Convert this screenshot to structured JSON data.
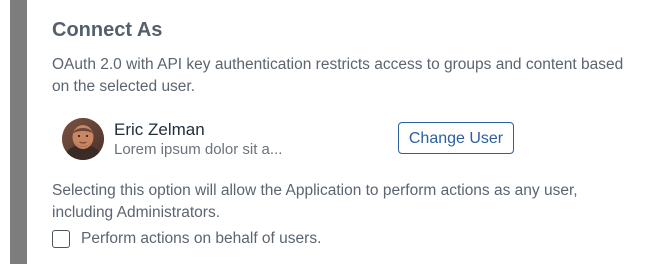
{
  "section": {
    "title": "Connect As",
    "description": "OAuth 2.0 with API key authentication restricts access to groups and content based on the selected user."
  },
  "user": {
    "name": "Eric Zelman",
    "subtext": "Lorem ipsum dolor sit a..."
  },
  "actions": {
    "change_user_label": "Change User"
  },
  "note": {
    "text": "Selecting this option will allow the Application to perform actions as any user, including Administrators."
  },
  "option": {
    "checkbox_label": "Perform actions on behalf of users.",
    "checked": false
  },
  "colors": {
    "accent": "#2d5fa0",
    "rail": "#7d7d7d",
    "text": "#5b6570"
  },
  "icons": {
    "avatar": "user-avatar-photo"
  }
}
